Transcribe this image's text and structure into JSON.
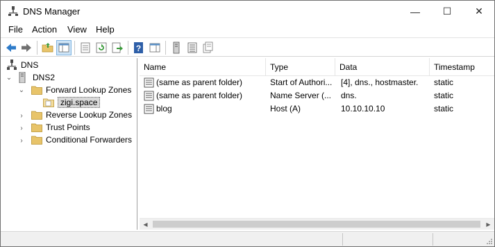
{
  "window": {
    "title": "DNS Manager",
    "controls": {
      "minimize": "—",
      "maximize": "☐",
      "close": "✕"
    }
  },
  "menu": [
    "File",
    "Action",
    "View",
    "Help"
  ],
  "toolbar": {
    "buttons": [
      "back-icon",
      "forward-icon",
      "up-folder-icon",
      "show-hide-tree-icon",
      "properties-icon",
      "refresh-icon",
      "export-list-icon",
      "help-icon",
      "action-pane-icon",
      "server-icon",
      "zone-icon",
      "record-icon"
    ]
  },
  "tree": {
    "root": "DNS",
    "server": "DNS2",
    "items": [
      {
        "label": "Forward Lookup Zones",
        "expanded": true
      },
      {
        "label": "zigi.space",
        "selected": true
      },
      {
        "label": "Reverse Lookup Zones"
      },
      {
        "label": "Trust Points"
      },
      {
        "label": "Conditional Forwarders"
      }
    ]
  },
  "list": {
    "columns": [
      "Name",
      "Type",
      "Data",
      "Timestamp"
    ],
    "rows": [
      {
        "name": "(same as parent folder)",
        "type": "Start of Authori...",
        "data": "[4], dns., hostmaster.",
        "timestamp": "static"
      },
      {
        "name": "(same as parent folder)",
        "type": "Name Server (...",
        "data": "dns.",
        "timestamp": "static"
      },
      {
        "name": "blog",
        "type": "Host (A)",
        "data": "10.10.10.10",
        "timestamp": "static"
      }
    ]
  },
  "colors": {
    "folder": "#e8c46a",
    "arrow_blue": "#2e7bc9",
    "arrow_green": "#3a9a3a"
  }
}
